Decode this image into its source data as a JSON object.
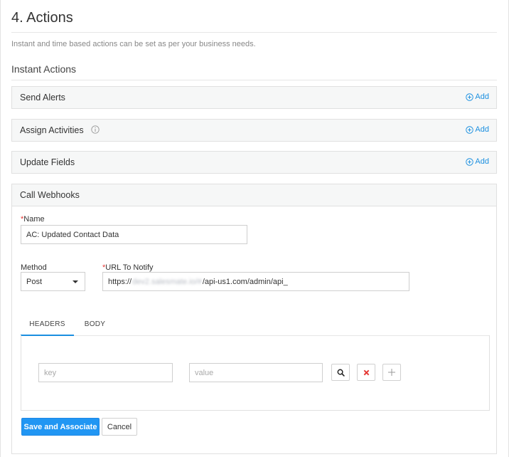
{
  "page": {
    "title": "4. Actions",
    "description": "Instant and time based actions can be set as per your business needs.",
    "section_heading": "Instant Actions"
  },
  "actions": [
    {
      "title": "Send Alerts",
      "add_label": "Add",
      "has_info": false
    },
    {
      "title": "Assign Activities",
      "add_label": "Add",
      "has_info": true
    },
    {
      "title": "Update Fields",
      "add_label": "Add",
      "has_info": false
    }
  ],
  "webhook": {
    "title": "Call Webhooks",
    "name_label": "Name",
    "name_value": "AC: Updated Contact Data",
    "method_label": "Method",
    "method_value": "Post",
    "url_label": "URL To Notify",
    "url_prefix": "https://",
    "url_blurred": "dev2.salesmate.io/#",
    "url_suffix": "/api-us1.com/admin/api_",
    "tabs": [
      "HEADERS",
      "BODY"
    ],
    "active_tab": "HEADERS",
    "key_placeholder": "key",
    "value_placeholder": "value",
    "save_label": "Save and Associate",
    "cancel_label": "Cancel"
  },
  "icons": {
    "add": "plus-circle-icon",
    "info": "info-circle-icon",
    "search": "search-icon",
    "remove": "close-icon",
    "add_row": "plus-icon"
  },
  "colors": {
    "accent": "#1a8fe0",
    "primary_button": "#2196f3",
    "required": "#e53935",
    "remove": "#e53935"
  }
}
